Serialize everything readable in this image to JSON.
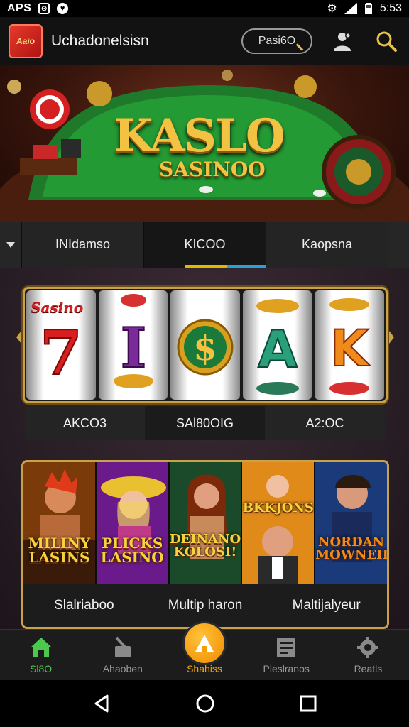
{
  "status_bar": {
    "carrier": "APS",
    "time": "5:53"
  },
  "app_bar": {
    "logo_text": "Aaio",
    "title": "Uchadonelsisn",
    "search_pill": "Pasi6O"
  },
  "hero": {
    "title": "KASLO",
    "subtitle": "SASINOO"
  },
  "tabs": [
    {
      "label": "INIdamso"
    },
    {
      "label": "KICOO"
    },
    {
      "label": "Kaopsna"
    }
  ],
  "slot": {
    "overlay_text": "Sasino",
    "reels": [
      "7",
      "I",
      "$",
      "A",
      "K"
    ],
    "labels": [
      "AKCO3",
      "SAl80OIG",
      "A2:OC"
    ]
  },
  "games": [
    {
      "title": "MILINY LASINS",
      "label": "Slalriaboo"
    },
    {
      "title": "PLICKS LASINO",
      "label": "Multip haron"
    },
    {
      "title": "DEINANO KOLOSI!",
      "label": ""
    },
    {
      "title": "BKKJONS",
      "label": "Maltijalyeur"
    },
    {
      "title": "NORDAN MOWNEILL",
      "label": ""
    }
  ],
  "bottom_nav": [
    {
      "label": "Sl8O",
      "icon": "home-icon"
    },
    {
      "label": "Ahaoben",
      "icon": "broom-icon"
    },
    {
      "label": "Shahiss",
      "icon": "triangle-icon"
    },
    {
      "label": "Pleslranos",
      "icon": "list-icon"
    },
    {
      "label": "Reatls",
      "icon": "gear-icon"
    }
  ],
  "colors": {
    "accent_gold": "#c8a248",
    "active_green": "#4cc84c",
    "fab_orange": "#f08a00"
  }
}
